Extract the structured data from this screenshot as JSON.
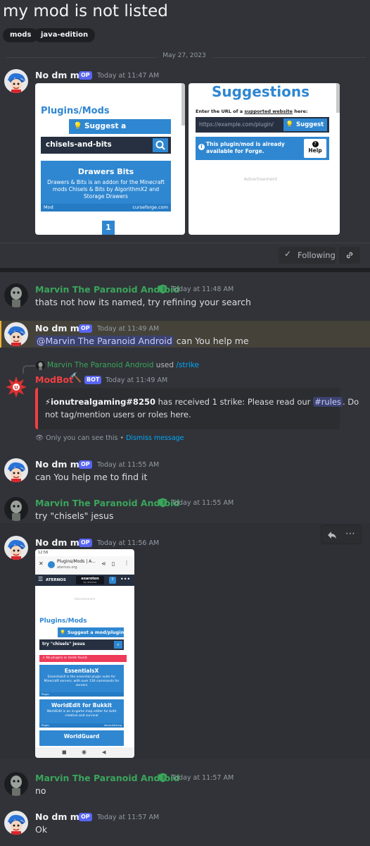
{
  "thread": {
    "title": "my mod is not listed",
    "tags": [
      "mods",
      "java-edition"
    ],
    "date_divider": "May 27, 2023"
  },
  "users": {
    "op_name": "No dm me",
    "op_badge": "OP",
    "marvin_name": "Marvin The Paranoid Android",
    "bot_name": "ModBot",
    "bot_badge": "BOT"
  },
  "messages": [
    {
      "time": "Today at 11:47 AM"
    },
    {
      "time": "Today at 11:48 AM",
      "text": "thats not how its named, try refining your search"
    },
    {
      "time": "Today at 11:49 AM",
      "mention": "@Marvin The Paranoid Android",
      "text": "can You help me"
    },
    {
      "reply_user": "Marvin The Paranoid Android",
      "reply_used": "used",
      "reply_command": "/strike",
      "time": "Today at 11:49 AM",
      "embed_user": "ionutrealgaming#8250",
      "embed_text1": "has received 1 strike: Please read our",
      "embed_channel": "rules",
      "embed_text2": ". Do",
      "embed_text3": "not tag/mention users or roles here.",
      "ephemeral": "Only you can see this",
      "dot": "•",
      "dismiss": "Dismiss message"
    },
    {
      "time": "Today at 11:55 AM",
      "text": "can You help me to find it"
    },
    {
      "time": "Today at 11:55 AM",
      "text": "try \"chisels\" jesus"
    },
    {
      "time": "Today at 11:56 AM"
    },
    {
      "time": "Today at 11:57 AM",
      "text": "no"
    },
    {
      "time": "Today at 11:57 AM",
      "text": "Ok"
    }
  ],
  "thread_actions": {
    "following": "Following"
  },
  "img1": {
    "heading": "Plugins/Mods",
    "suggest_btn": "Suggest a mod/plugin",
    "search_value": "chisels-and-bits",
    "card_title": "Drawers Bits",
    "card_desc": "Drawers & Bits is an addon for the Minecraft mods Chisels & Bits by AlgorithmX2 and Storage Drawers",
    "card_type": "Mod",
    "card_source": "curseforge.com",
    "page": "1"
  },
  "img2": {
    "heading": "Suggestions",
    "prompt_pre": "Enter the URL of a",
    "prompt_link": "supported website",
    "prompt_post": "here:",
    "url_placeholder": "https://example.com/plugin/",
    "suggest_btn": "Suggest",
    "notice": "This plugin/mod is already available for Forge.",
    "help_btn": "Help",
    "ad": "Advertisement"
  },
  "phone": {
    "status_time": "12:56",
    "tab_title": "Plugins/Mods | A...",
    "tab_url": "aternos.org",
    "brand": "ATERNOS",
    "partner": "exaroton",
    "partner_sub": "by aternos",
    "ad": "Advertisement",
    "heading": "Plugins/Mods",
    "suggest_btn": "Suggest a mod/plugin",
    "search_value": "try \"chisels\" jesus",
    "error": "No plugins or mods found.",
    "results": [
      {
        "title": "EssentialsX",
        "desc": "EssentialsX is the essential plugin suite for Minecraft servers, with over 130 commands for servers",
        "type": "Plugin",
        "source": ""
      },
      {
        "title": "WorldEdit for Bukkit",
        "desc": "WorldEdit is an in-game map editor for both creative and survival",
        "type": "Plugin",
        "source": "dev.bukkit.org"
      },
      {
        "title": "WorldGuard",
        "desc": "",
        "type": "",
        "source": ""
      }
    ]
  },
  "colors": {
    "bg": "#313338",
    "accent": "#5865f2",
    "green": "#3ba55c",
    "red": "#f23f43",
    "link": "#00a8fc",
    "aternos_blue": "#2f87d1"
  }
}
